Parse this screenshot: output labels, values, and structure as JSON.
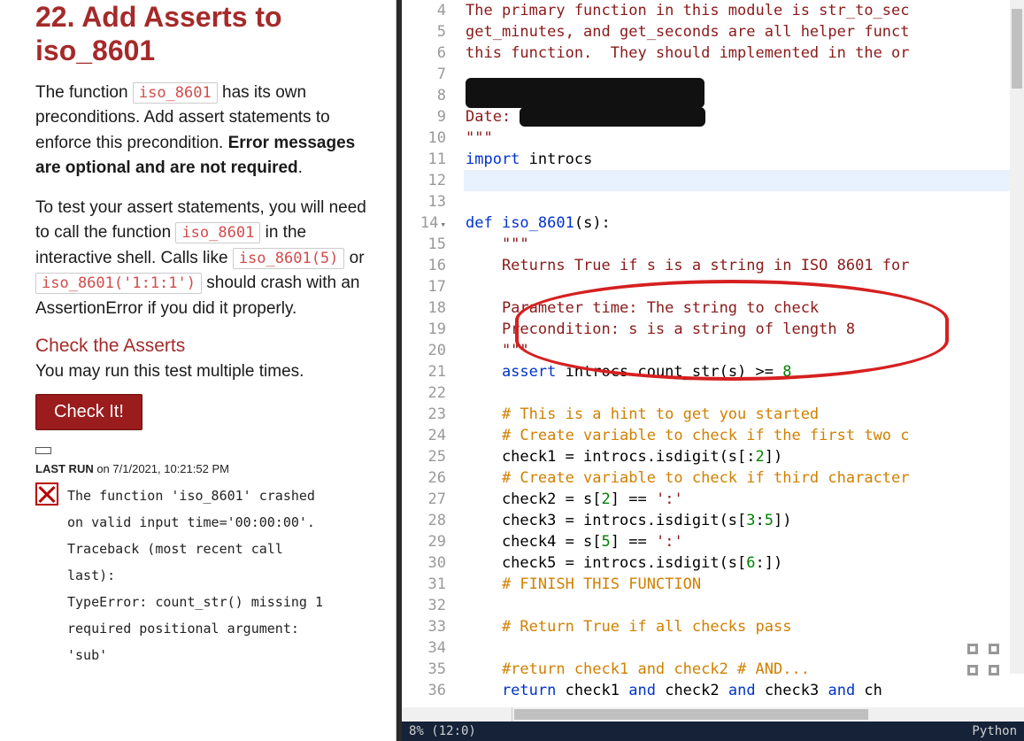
{
  "left": {
    "title": "22. Add Asserts to iso_8601",
    "para1_a": "The function ",
    "para1_code1": "iso_8601",
    "para1_b": " has its own preconditions. Add assert statements to enforce this precondition. ",
    "para1_bold": "Error messages are optional and are not required",
    "para1_c": ".",
    "para2_a": "To test your assert statements, you will need to call the function ",
    "para2_code1": "iso_8601",
    "para2_b": " in the interactive shell. Calls like ",
    "para2_code2": "iso_8601(5)",
    "para2_c": " or ",
    "para2_code3": "iso_8601('1:1:1')",
    "para2_d": " should crash with an AssertionError if you did it properly.",
    "subhead": "Check the Asserts",
    "runinfo": "You may run this test multiple times.",
    "check_btn": "Check It!",
    "lastrun_label": "LAST RUN",
    "lastrun_time": " on 7/1/2021, 10:21:52 PM",
    "error_text": "The function 'iso_8601' crashed\non valid input time='00:00:00'.\nTraceback (most recent call\nlast):\nTypeError: count_str() missing 1\nrequired positional argument:\n'sub'"
  },
  "editor": {
    "first_line_no": 4,
    "last_line_no": 36,
    "lines": {
      "4": {
        "t": "str",
        "v": "The primary function in this module is str_to_sec"
      },
      "5": {
        "t": "str",
        "v": "get_minutes, and get_seconds are all helper funct"
      },
      "6": {
        "t": "str",
        "v": "this function.  They should implemented in the or"
      },
      "7": {
        "t": "blank",
        "v": ""
      },
      "8": {
        "t": "redact",
        "v": ""
      },
      "9": {
        "t": "dateredact",
        "v": "Date: "
      },
      "10": {
        "t": "str",
        "v": "\"\"\""
      },
      "11": {
        "t": "import",
        "kw": "import",
        "rest": " introcs"
      },
      "12": {
        "t": "hl",
        "v": ""
      },
      "13": {
        "t": "blank",
        "v": ""
      },
      "14": {
        "t": "def",
        "kw": "def ",
        "name": "iso_8601",
        "rest": "(s):"
      },
      "15": {
        "t": "str",
        "v": "    \"\"\""
      },
      "16": {
        "t": "str",
        "v": "    Returns True if s is a string in ISO 8601 for"
      },
      "17": {
        "t": "blank",
        "v": ""
      },
      "18": {
        "t": "str",
        "v": "    Parameter time: The string to check"
      },
      "19": {
        "t": "str",
        "v": "    Precondition: s is a string of length 8"
      },
      "20": {
        "t": "str",
        "v": "    \"\"\""
      },
      "21": {
        "t": "assert",
        "kw": "    assert",
        "rest": " introcs.count_str(s) >= ",
        "num": "8"
      },
      "22": {
        "t": "blank",
        "v": ""
      },
      "23": {
        "t": "cmt",
        "v": "    # This is a hint to get you started"
      },
      "24": {
        "t": "cmt",
        "v": "    # Create variable to check if the first two c"
      },
      "25": {
        "t": "code",
        "pre": "    check1 = introcs.isdigit(s[:",
        "num": "2",
        "post": "])"
      },
      "26": {
        "t": "cmt",
        "v": "    # Create variable to check if third character"
      },
      "27": {
        "t": "code2",
        "pre": "    check2 = s[",
        "num": "2",
        "mid": "] == ",
        "str": "':'"
      },
      "28": {
        "t": "code3",
        "pre": "    check3 = introcs.isdigit(s[",
        "num1": "3",
        "colon": ":",
        "num2": "5",
        "post": "])"
      },
      "29": {
        "t": "code2",
        "pre": "    check4 = s[",
        "num": "5",
        "mid": "] == ",
        "str": "':'"
      },
      "30": {
        "t": "code",
        "pre": "    check5 = introcs.isdigit(s[",
        "num": "6",
        "post": ":])"
      },
      "31": {
        "t": "cmt",
        "v": "    # FINISH THIS FUNCTION"
      },
      "32": {
        "t": "blank",
        "v": ""
      },
      "33": {
        "t": "cmt",
        "v": "    # Return True if all checks pass"
      },
      "34": {
        "t": "blank",
        "v": ""
      },
      "35": {
        "t": "cmt",
        "v": "    #return check1 and check2 # AND..."
      },
      "36": {
        "t": "return",
        "kw": "    return",
        "rest": " check1 ",
        "and1": "and",
        "r2": " check2 ",
        "and2": "and",
        "r3": " check3 ",
        "and3": "and",
        "r4": " ch"
      }
    }
  },
  "status": {
    "left": "8%  (12:0)",
    "right": "Python"
  }
}
